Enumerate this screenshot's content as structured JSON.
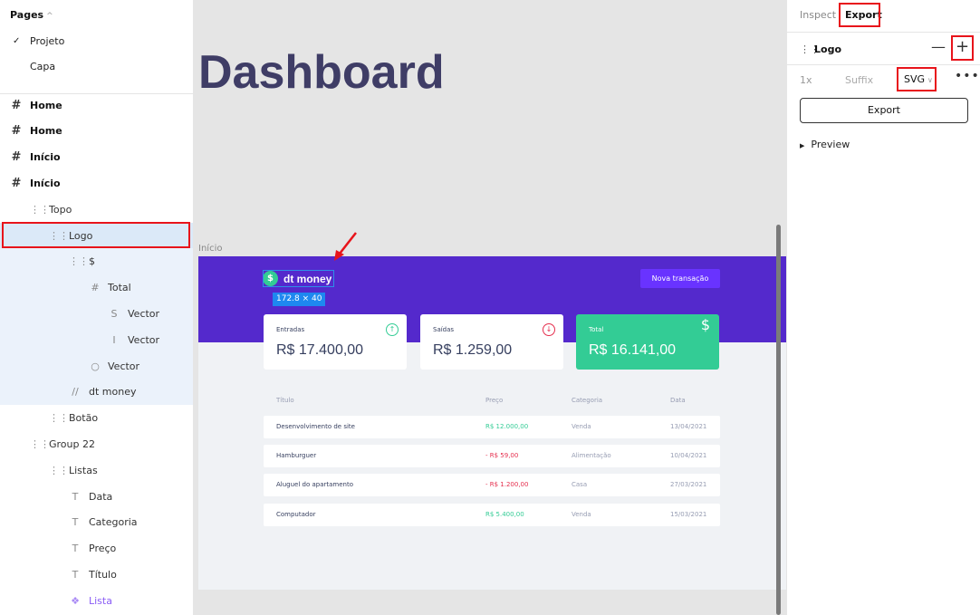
{
  "left_panel": {
    "pages_title": "Pages",
    "pages": [
      {
        "label": "Projeto",
        "checked": true
      },
      {
        "label": "Capa",
        "checked": false
      }
    ],
    "layers": [
      {
        "label": "Home",
        "icon": "#"
      },
      {
        "label": "Home",
        "icon": "#"
      },
      {
        "label": "Início",
        "icon": "#"
      },
      {
        "label": "Início",
        "icon": "#"
      },
      {
        "label": "Topo",
        "icon": "⋮⋮"
      },
      {
        "label": "Logo",
        "icon": "⋮⋮"
      },
      {
        "label": "$",
        "icon": "⋮⋮"
      },
      {
        "label": "Total",
        "icon": "#"
      },
      {
        "label": "Vector",
        "icon": "S"
      },
      {
        "label": "Vector",
        "icon": "I"
      },
      {
        "label": "Vector",
        "icon": "○"
      },
      {
        "label": "dt money",
        "icon": "//"
      },
      {
        "label": "Botão",
        "icon": "⋮⋮"
      },
      {
        "label": "Group 22",
        "icon": "⋮⋮"
      },
      {
        "label": "Listas",
        "icon": "⋮⋮"
      },
      {
        "label": "Data",
        "icon": "T"
      },
      {
        "label": "Categoria",
        "icon": "T"
      },
      {
        "label": "Preço",
        "icon": "T"
      },
      {
        "label": "Título",
        "icon": "T"
      },
      {
        "label": "Lista",
        "icon": "❖"
      }
    ]
  },
  "canvas": {
    "heading": "Dashboard",
    "frame_label": "Início",
    "selection_size": "172.8 × 40",
    "app": {
      "logo_icon": "$",
      "logo_text": "dt money",
      "new_button": "Nova transação",
      "cards": [
        {
          "title": "Entradas",
          "value": "R$ 17.400,00",
          "icon": "↑",
          "color": "#33cc95"
        },
        {
          "title": "Saídas",
          "value": "R$ 1.259,00",
          "icon": "↓",
          "color": "#e52e4d"
        },
        {
          "title": "Total",
          "value": "R$ 16.141,00",
          "icon": "$",
          "color": "#ffffff"
        }
      ],
      "table_headers": [
        "Título",
        "Preço",
        "Categoria",
        "Data"
      ],
      "rows": [
        {
          "title": "Desenvolvimento de site",
          "price": "R$ 12.000,00",
          "category": "Venda",
          "date": "13/04/2021",
          "type": "pos"
        },
        {
          "title": "Hamburguer",
          "price": "- R$ 59,00",
          "category": "Alimentação",
          "date": "10/04/2021",
          "type": "neg"
        },
        {
          "title": "Aluguel do apartamento",
          "price": "- R$ 1.200,00",
          "category": "Casa",
          "date": "27/03/2021",
          "type": "neg"
        },
        {
          "title": "Computador",
          "price": "R$ 5.400,00",
          "category": "Venda",
          "date": "15/03/2021",
          "type": "pos"
        }
      ]
    }
  },
  "right_panel": {
    "tabs": [
      "Inspect",
      "Export"
    ],
    "layer_name": "Logo",
    "scale": "1x",
    "suffix_placeholder": "Suffix",
    "format": "SVG",
    "export_button": "Export",
    "preview_label": "Preview"
  },
  "colors": {
    "highlight": "#e8141b",
    "app_purple": "#5429cc",
    "app_green": "#33cc95",
    "app_red": "#e52e4d",
    "selection_blue": "#1e88f0"
  }
}
